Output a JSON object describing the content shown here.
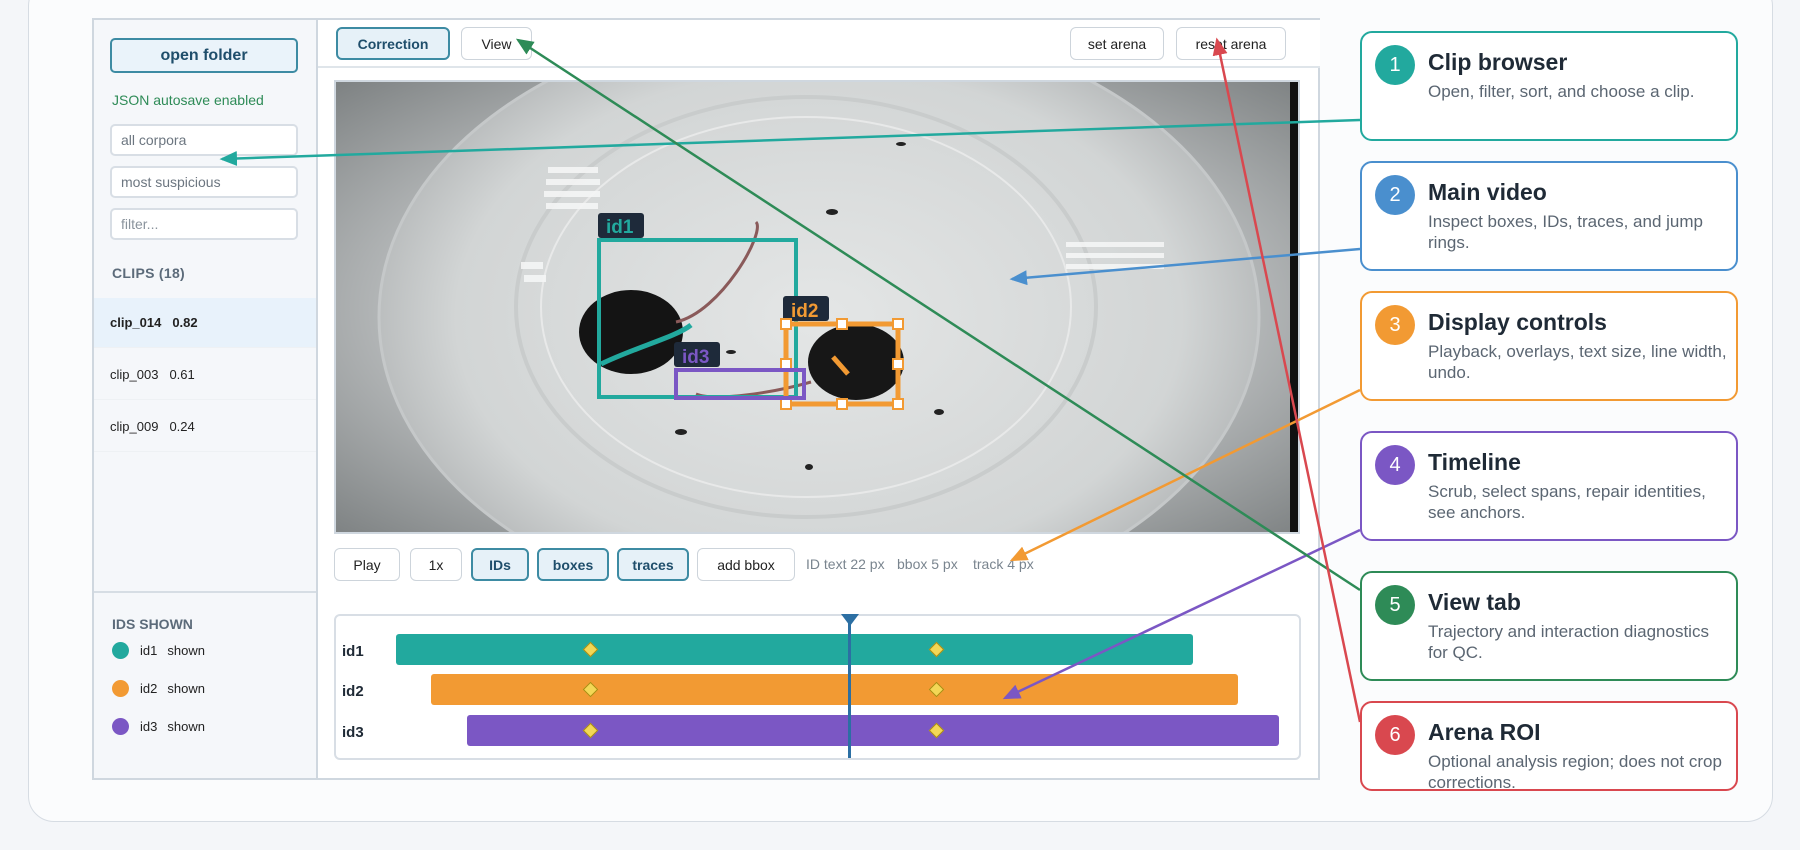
{
  "sidebar": {
    "open_folder": "open folder",
    "autosave": "JSON autosave enabled",
    "corpus_value": "all corpora",
    "sort_value": "most suspicious",
    "filter_placeholder": "filter...",
    "clips_title": "CLIPS (18)",
    "clips": [
      {
        "name": "clip_014",
        "score": "0.82"
      },
      {
        "name": "clip_003",
        "score": "0.61"
      },
      {
        "name": "clip_009",
        "score": "0.24"
      }
    ],
    "ids_title": "IDS SHOWN",
    "ids": [
      {
        "id": "id1",
        "state": "shown",
        "color": "#22a99e"
      },
      {
        "id": "id2",
        "state": "shown",
        "color": "#f29a33"
      },
      {
        "id": "id3",
        "state": "shown",
        "color": "#7b57c4"
      }
    ]
  },
  "tabs": {
    "correction": "Correction",
    "view": "View",
    "set_arena": "set arena",
    "reset_arena": "reset arena"
  },
  "video": {
    "labels": {
      "id1": "id1",
      "id2": "id2",
      "id3": "id3"
    }
  },
  "controls": {
    "play": "Play",
    "speed": "1x",
    "ids": "IDs",
    "boxes": "boxes",
    "traces": "traces",
    "add_bbox": "add bbox",
    "id_text": "ID text 22 px",
    "bbox": "bbox 5 px",
    "track": "track 4 px"
  },
  "timeline": {
    "rows": [
      {
        "label": "id1",
        "color": "#22a99e"
      },
      {
        "label": "id2",
        "color": "#f29a33"
      },
      {
        "label": "id3",
        "color": "#7b57c4"
      }
    ]
  },
  "callouts": [
    {
      "num": "1",
      "title": "Clip browser",
      "desc": "Open, filter, sort, and choose a clip.",
      "color": "#22a99e"
    },
    {
      "num": "2",
      "title": "Main video",
      "desc": "Inspect boxes, IDs, traces, and jump rings.",
      "color": "#4a8fce"
    },
    {
      "num": "3",
      "title": "Display controls",
      "desc": "Playback, overlays, text size, line width, undo.",
      "color": "#f29a33"
    },
    {
      "num": "4",
      "title": "Timeline",
      "desc": "Scrub, select spans, repair identities, see anchors.",
      "color": "#7b57c4"
    },
    {
      "num": "5",
      "title": "View tab",
      "desc": "Trajectory and interaction diagnostics for QC.",
      "color": "#2e8b57"
    },
    {
      "num": "6",
      "title": "Arena ROI",
      "desc": "Optional analysis region; does not crop corrections.",
      "color": "#d9484f"
    }
  ]
}
